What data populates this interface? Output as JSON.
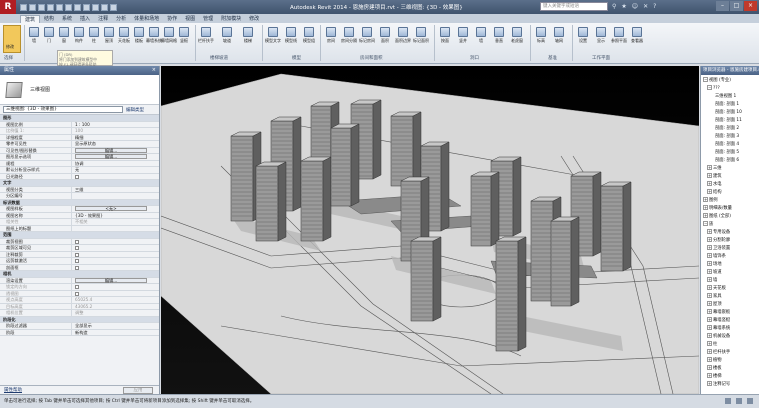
{
  "titlebar": {
    "logo": "R",
    "title": "Autodesk Revit 2014 -   恩施房建项目.rvt - 三维视图: {3D - 效果图}",
    "search_placeholder": "键入关键字或短语",
    "min": "–",
    "max": "□",
    "close": "×"
  },
  "tabs": [
    "建筑",
    "结构",
    "系统",
    "插入",
    "注释",
    "分析",
    "体量和场地",
    "协作",
    "视图",
    "管理",
    "附加模块",
    "修改"
  ],
  "ribbon": {
    "modify_label": "修改",
    "select_label": "选择",
    "groups": [
      "构建",
      "楼梯坡道",
      "模型",
      "房间和面积",
      "洞口",
      "基准",
      "工作平面"
    ],
    "buttons": [
      "墙",
      "门",
      "窗",
      "构件",
      "柱",
      "屋顶",
      "天花板",
      "楼板",
      "幕墙系统",
      "幕墙网格",
      "竖梃",
      "栏杆扶手",
      "坡道",
      "楼梯",
      "模型文字",
      "模型线",
      "模型组",
      "房间",
      "房间分隔",
      "标记房间",
      "面积",
      "面积边界",
      "标记面积",
      "按面",
      "竖井",
      "墙",
      "垂直",
      "老虎窗",
      "标高",
      "轴网",
      "设置",
      "显示",
      "参照平面",
      "查看器"
    ],
    "tooltip_lines": [
      "门 (DR)",
      "将门添加到建筑模型中",
      "按 F1 键获得更多帮助"
    ]
  },
  "properties": {
    "header": "属性",
    "close": "×",
    "type_name": "三维视图",
    "filter_value": "三维视图: {3D - 效果图}",
    "edit_type": "编辑类型",
    "rows": [
      {
        "k": "图形",
        "v": "",
        "section": true
      },
      {
        "k": "视图比例",
        "v": "1 : 100"
      },
      {
        "k": "比例值 1:",
        "v": "100",
        "dim": true
      },
      {
        "k": "详细程度",
        "v": "精细"
      },
      {
        "k": "零件可见性",
        "v": "显示原状态"
      },
      {
        "k": "可见性/图形替换",
        "v": "编辑...",
        "btn": true
      },
      {
        "k": "图形显示选项",
        "v": "编辑...",
        "btn": true
      },
      {
        "k": "规程",
        "v": "协调"
      },
      {
        "k": "默认分析显示样式",
        "v": "无"
      },
      {
        "k": "日光路径",
        "v": "",
        "chk": true
      },
      {
        "k": "文字",
        "v": "",
        "section": true
      },
      {
        "k": "视图分类",
        "v": "三维"
      },
      {
        "k": "分区编号",
        "v": ""
      },
      {
        "k": "标识数据",
        "v": "",
        "section": true
      },
      {
        "k": "视图样板",
        "v": "<无>",
        "btn": true
      },
      {
        "k": "视图名称",
        "v": "{3D - 效果图}"
      },
      {
        "k": "相关性",
        "v": "不相关",
        "dim": true
      },
      {
        "k": "图纸上的标题",
        "v": ""
      },
      {
        "k": "范围",
        "v": "",
        "section": true
      },
      {
        "k": "裁剪视图",
        "v": "",
        "chk": true
      },
      {
        "k": "裁剪区域可见",
        "v": "",
        "chk": true
      },
      {
        "k": "注释裁剪",
        "v": "",
        "chk": true
      },
      {
        "k": "远剪裁激活",
        "v": "",
        "chk": true
      },
      {
        "k": "剖面框",
        "v": "",
        "chk": true
      },
      {
        "k": "相机",
        "v": "",
        "section": true
      },
      {
        "k": "渲染设置",
        "v": "编辑...",
        "btn": true
      },
      {
        "k": "锁定的方向",
        "v": "",
        "chk": true,
        "dim": true
      },
      {
        "k": "透视图",
        "v": "",
        "chk": true,
        "dim": true
      },
      {
        "k": "视点高度",
        "v": "65025.4",
        "dim": true
      },
      {
        "k": "目标高度",
        "v": "43065.2",
        "dim": true
      },
      {
        "k": "相机位置",
        "v": "调整",
        "dim": true
      },
      {
        "k": "阶段化",
        "v": "",
        "section": true
      },
      {
        "k": "阶段过滤器",
        "v": "全部显示"
      },
      {
        "k": "阶段",
        "v": "新构造"
      }
    ],
    "help": "属性帮助",
    "apply": "应用"
  },
  "browser": {
    "header": "项目浏览器 - 恩施房建项目.rvt",
    "items": [
      {
        "t": "−",
        "label": "视图 (专业)",
        "indent": 0
      },
      {
        "t": "−",
        "label": "???",
        "indent": 1
      },
      {
        "t": "",
        "label": "三维视图 1",
        "indent": 3
      },
      {
        "t": "",
        "label": "剖面: 剖面 1",
        "indent": 3
      },
      {
        "t": "",
        "label": "剖面: 剖面 10",
        "indent": 3
      },
      {
        "t": "",
        "label": "剖面: 剖面 11",
        "indent": 3
      },
      {
        "t": "",
        "label": "剖面: 剖面 2",
        "indent": 3
      },
      {
        "t": "",
        "label": "剖面: 剖面 3",
        "indent": 3
      },
      {
        "t": "",
        "label": "剖面: 剖面 4",
        "indent": 3
      },
      {
        "t": "",
        "label": "剖面: 剖面 5",
        "indent": 3
      },
      {
        "t": "",
        "label": "剖面: 剖面 6",
        "indent": 3
      },
      {
        "t": "+",
        "label": "三维",
        "indent": 1
      },
      {
        "t": "+",
        "label": "建筑",
        "indent": 1
      },
      {
        "t": "+",
        "label": "水电",
        "indent": 1
      },
      {
        "t": "+",
        "label": "结构",
        "indent": 1
      },
      {
        "t": "+",
        "label": "图例",
        "indent": 0
      },
      {
        "t": "+",
        "label": "明细表/数量",
        "indent": 0
      },
      {
        "t": "+",
        "label": "图纸 (全部)",
        "indent": 0
      },
      {
        "t": "−",
        "label": "族",
        "indent": 0
      },
      {
        "t": "+",
        "label": "专用设备",
        "indent": 1
      },
      {
        "t": "+",
        "label": "分割轮廓",
        "indent": 1
      },
      {
        "t": "+",
        "label": "卫浴装置",
        "indent": 1
      },
      {
        "t": "+",
        "label": "墙饰条",
        "indent": 1
      },
      {
        "t": "+",
        "label": "场地",
        "indent": 1
      },
      {
        "t": "+",
        "label": "坡道",
        "indent": 1
      },
      {
        "t": "+",
        "label": "墙",
        "indent": 1
      },
      {
        "t": "+",
        "label": "天花板",
        "indent": 1
      },
      {
        "t": "+",
        "label": "家具",
        "indent": 1
      },
      {
        "t": "+",
        "label": "屋顶",
        "indent": 1
      },
      {
        "t": "+",
        "label": "幕墙嵌板",
        "indent": 1
      },
      {
        "t": "+",
        "label": "幕墙竖梃",
        "indent": 1
      },
      {
        "t": "+",
        "label": "幕墙系统",
        "indent": 1
      },
      {
        "t": "+",
        "label": "机械设备",
        "indent": 1
      },
      {
        "t": "+",
        "label": "柱",
        "indent": 1
      },
      {
        "t": "+",
        "label": "栏杆扶手",
        "indent": 1
      },
      {
        "t": "+",
        "label": "植物",
        "indent": 1
      },
      {
        "t": "+",
        "label": "楼板",
        "indent": 1
      },
      {
        "t": "+",
        "label": "楼梯",
        "indent": 1
      },
      {
        "t": "+",
        "label": "注释记号",
        "indent": 1
      }
    ]
  },
  "status": {
    "text": "单击可进行选择; 按 Tab 键并单击可选择其他项目; 按 Ctrl 键并单击可将新项目添加到选择集; 按 Shift 键并单击可取消选择。",
    "model": ":0"
  }
}
